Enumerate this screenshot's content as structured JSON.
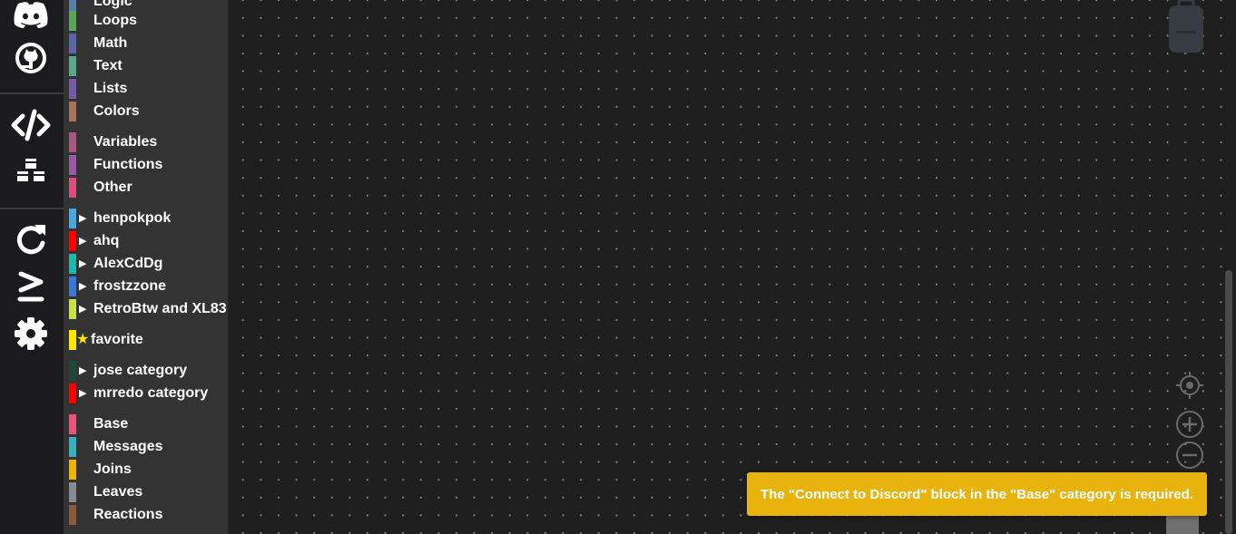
{
  "rail": {
    "icons": [
      "discord-icon",
      "github-icon",
      "code-icon",
      "cubes-icon",
      "redo-icon",
      "greater-equal-icon",
      "gear-icon"
    ]
  },
  "toolbox": {
    "categories": [
      {
        "label": "Logic",
        "color": "#5b80a5",
        "arrow": false
      },
      {
        "label": "Loops",
        "color": "#5ba55b",
        "arrow": false
      },
      {
        "label": "Math",
        "color": "#5b67a5",
        "arrow": false
      },
      {
        "label": "Text",
        "color": "#5ba58c",
        "arrow": false
      },
      {
        "label": "Lists",
        "color": "#745ba5",
        "arrow": false
      },
      {
        "label": "Colors",
        "color": "#a5745b",
        "arrow": false
      },
      {
        "label": "Variables",
        "color": "#a55b80",
        "arrow": false
      },
      {
        "label": "Functions",
        "color": "#995ba5",
        "arrow": false
      },
      {
        "label": "Other",
        "color": "#d94f7f",
        "arrow": false
      },
      {
        "label": "henpokpok",
        "color": "#4aa8e0",
        "arrow": true
      },
      {
        "label": "ahq",
        "color": "#ff0000",
        "arrow": true
      },
      {
        "label": "AlexCdDg",
        "color": "#1fb8a8",
        "arrow": true
      },
      {
        "label": "frostzzone",
        "color": "#3a78d8",
        "arrow": true
      },
      {
        "label": "RetroBtw and XL83",
        "color": "#c8e04a",
        "arrow": true
      },
      {
        "label": "favorite",
        "color": "#ffe800",
        "arrow": false,
        "star": true
      },
      {
        "label": "jose category",
        "color": "#1f4a3a",
        "arrow": true
      },
      {
        "label": "mrredo category",
        "color": "#ff0000",
        "arrow": true
      },
      {
        "label": "Base",
        "color": "#e8547a",
        "arrow": false
      },
      {
        "label": "Messages",
        "color": "#3ab0c0",
        "arrow": false
      },
      {
        "label": "Joins",
        "color": "#f0b400",
        "arrow": false
      },
      {
        "label": "Leaves",
        "color": "#8a8a94",
        "arrow": false
      },
      {
        "label": "Reactions",
        "color": "#8a5a3a",
        "arrow": false
      }
    ]
  },
  "workspace": {
    "controls": [
      "recenter-icon",
      "zoom-in-icon",
      "zoom-out-icon",
      "trashcan-icon"
    ]
  },
  "toast": {
    "message": "The \"Connect to Discord\" block in the \"Base\" category is required.",
    "color": "#e9b30e"
  }
}
